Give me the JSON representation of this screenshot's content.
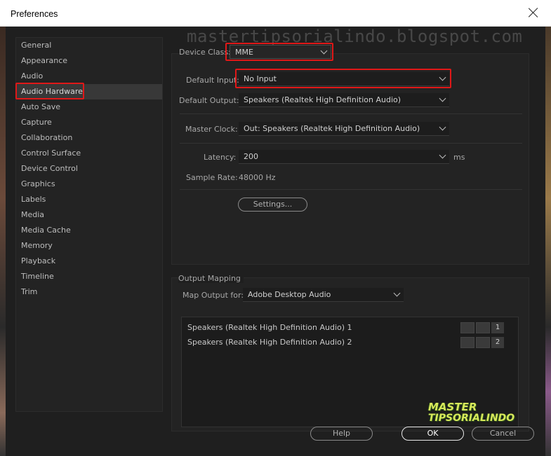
{
  "window": {
    "title": "Preferences"
  },
  "watermark": "mastertipsorialindo.blogspot.com",
  "logo": {
    "line1": "MASTER",
    "line2": "TIPSORIALINDO"
  },
  "sidebar": {
    "items": [
      {
        "label": "General"
      },
      {
        "label": "Appearance"
      },
      {
        "label": "Audio"
      },
      {
        "label": "Audio Hardware",
        "active": true
      },
      {
        "label": "Auto Save"
      },
      {
        "label": "Capture"
      },
      {
        "label": "Collaboration"
      },
      {
        "label": "Control Surface"
      },
      {
        "label": "Device Control"
      },
      {
        "label": "Graphics"
      },
      {
        "label": "Labels"
      },
      {
        "label": "Media"
      },
      {
        "label": "Media Cache"
      },
      {
        "label": "Memory"
      },
      {
        "label": "Playback"
      },
      {
        "label": "Timeline"
      },
      {
        "label": "Trim"
      }
    ]
  },
  "hardware": {
    "device_class_label": "Device Class:",
    "device_class_value": "MME",
    "default_input_label": "Default Input:",
    "default_input_value": "No Input",
    "default_output_label": "Default Output:",
    "default_output_value": "Speakers (Realtek High Definition Audio)",
    "master_clock_label": "Master Clock:",
    "master_clock_value": "Out: Speakers (Realtek High Definition Audio)",
    "latency_label": "Latency:",
    "latency_value": "200",
    "latency_unit": "ms",
    "sample_rate_label": "Sample Rate:",
    "sample_rate_value": "48000 Hz",
    "settings_button": "Settings..."
  },
  "output_mapping": {
    "section_label": "Output Mapping",
    "map_output_label": "Map Output for:",
    "map_output_value": "Adobe Desktop Audio",
    "channels": [
      {
        "label": "Speakers (Realtek High Definition Audio) 1",
        "number": "1"
      },
      {
        "label": "Speakers (Realtek High Definition Audio) 2",
        "number": "2"
      }
    ]
  },
  "footer": {
    "help": "Help",
    "ok": "OK",
    "cancel": "Cancel"
  },
  "colors": {
    "highlight": "#e01818",
    "panel": "#232323",
    "background": "#1f1f1f"
  }
}
